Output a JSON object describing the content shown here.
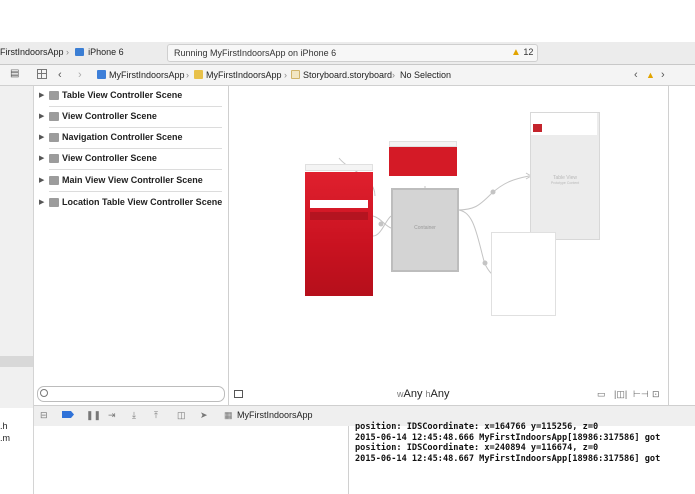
{
  "toolbar": {
    "scheme_app": "FirstIndoorsApp",
    "scheme_separator": "›",
    "scheme_device": "iPhone 6",
    "status_text": "Running MyFirstIndoorsApp on iPhone 6",
    "warning_count": "12"
  },
  "jumpbar": {
    "project": "MyFirstIndoorsApp",
    "group": "MyFirstIndoorsApp",
    "file": "Storyboard.storyboard",
    "selection": "No Selection",
    "sep": "›"
  },
  "outline": {
    "scenes": [
      {
        "label": "Table View Controller Scene"
      },
      {
        "label": "View Controller Scene"
      },
      {
        "label": "Navigation Controller Scene"
      },
      {
        "label": "View Controller Scene"
      },
      {
        "label": "Main View View Controller Scene"
      },
      {
        "label": "Location Table View Controller Scene"
      }
    ]
  },
  "canvas": {
    "size_w_prefix": "w",
    "size_w": "Any",
    "size_h_prefix": "h",
    "size_h": "Any",
    "container_label": "Container",
    "table_view_label": "Table View",
    "table_view_sub": "Prototype Content"
  },
  "debug": {
    "app_name": "MyFirstIndoorsApp"
  },
  "navigator": {
    "file_h": ".h",
    "file_m": ".m"
  },
  "console": {
    "lines": [
      "position: IDSCoordinate: x=164766 y=115256, z=0",
      "2015-06-14 12:45:48.666 MyFirstIndoorsApp[18986:317586] got",
      "position: IDSCoordinate: x=240894 y=116674, z=0",
      "2015-06-14 12:45:48.667 MyFirstIndoorsApp[18986:317586] got"
    ]
  },
  "colors": {
    "accent_blue": "#2f72d8",
    "scene_red": "#d41a26",
    "warning_yellow": "#e2a400"
  }
}
